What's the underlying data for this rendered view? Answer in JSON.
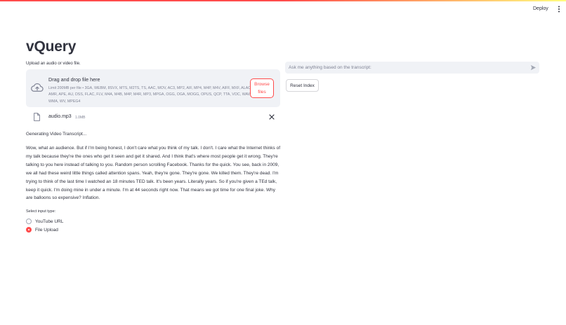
{
  "header": {
    "deploy_label": "Deploy",
    "menu_icon": "more-vertical-icon"
  },
  "app": {
    "title": "vQuery"
  },
  "uploader": {
    "label": "Upload an audio or video file.",
    "dropzone_title": "Drag and drop file here",
    "limit_text": "Limit 200MB per file • 3GA, WEBM, 8SVX, MTS, M2TS, TS, AAC, MOV, AC3, MP2, AIF, MP4, M4P, M4V, AIFF, MXF, ALAC, AMR, APE, AU, DSS, FLAC, FLV, M4A, M4B, M4P, M4R, MP3, MPGA, OGG, OGA, MOGG, OPUS, QCP, TTA, VOC, WAV, WMA, WV, MPEG4",
    "browse_label_line1": "Browse",
    "browse_label_line2": "files",
    "icon": "cloud-upload-icon"
  },
  "uploaded_file": {
    "name": "audio.mp3",
    "size": "1.0MB",
    "icon": "file-icon",
    "remove_icon": "close-icon"
  },
  "status_text": "Generating Video Transcript...",
  "transcript": "Wow, what an audience. But if I'm being honest, I don't care what you think of my talk. I don't. I care what the Internet thinks of my talk because they're the ones who get it seen and get it shared. And I think that's where most people get it wrong. They're talking to you here instead of talking to you. Random person scrolling Facebook. Thanks for the quick. You see, back in 2009, we all had these weird little things called attention spans. Yeah, they're gone. They're gone. We killed them. They're dead. I'm trying to think of the last time I watched an 18 minutes TED talk. It's been years. Literally years. So if you're given a TEd talk, keep it quick. I'm doing mine in under a minute. I'm at 44 seconds right now. That means we got time for one final joke. Why are balloons so expensive? Inflation.",
  "input_type": {
    "label": "Select input type:",
    "options": [
      {
        "label": "YouTube URL",
        "selected": false
      },
      {
        "label": "File Upload",
        "selected": true
      }
    ]
  },
  "chat": {
    "placeholder": "Ask me anything based on the transcript:",
    "send_icon": "send-icon"
  },
  "reset_label": "Reset Index",
  "colors": {
    "accent": "#ff4b4b",
    "text": "#31333f",
    "muted": "#808495",
    "panel_bg": "#f0f2f6"
  }
}
